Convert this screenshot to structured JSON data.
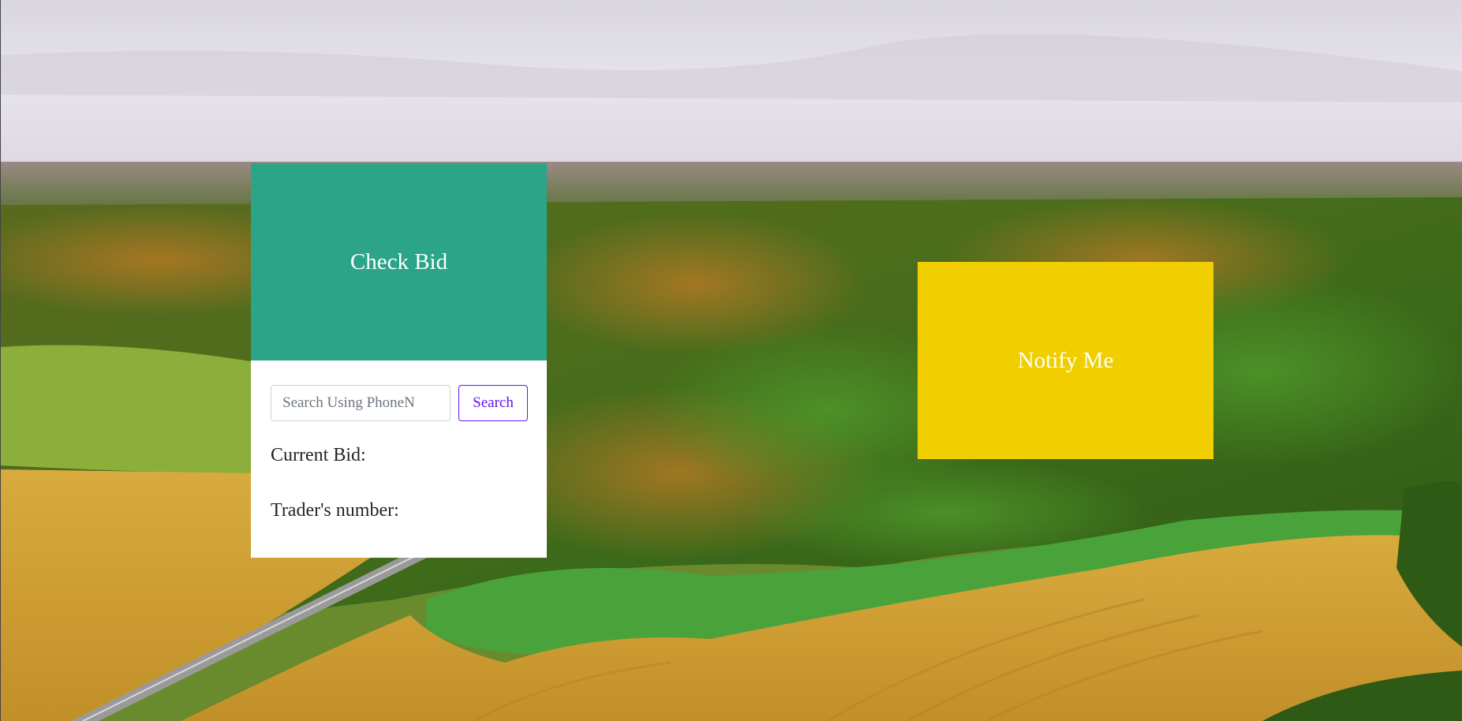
{
  "background": {
    "description_icon": "aerial-landscape-image",
    "colors": {
      "sky_top": "#dcd8e2",
      "sky_horizon": "#e6e3ec",
      "forest": "#3f6b1e",
      "field": "#d2a33a",
      "meadow": "#7ea83a"
    }
  },
  "check_bid": {
    "title": "Check Bid",
    "header_color": "#2ca488",
    "search": {
      "placeholder": "Search Using PhoneN",
      "value": "",
      "button_label": "Search",
      "button_color": "#6610f2"
    },
    "current_bid_label": "Current Bid:",
    "trader_number_label": "Trader's number:"
  },
  "notify": {
    "title": "Notify Me",
    "color": "#f0ce00"
  }
}
